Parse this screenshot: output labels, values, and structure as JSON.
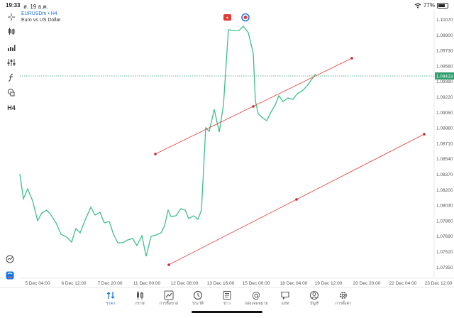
{
  "status": {
    "time": "19:33",
    "date": "ส. 19 ธ.ค.",
    "battery": "77%",
    "battery_level": 0.77
  },
  "symbol": {
    "name": "EURUSDm • H4",
    "description": "Euro vs US Dollar"
  },
  "toolbar": {
    "crosshair_icon": "crosshair-icon",
    "timeframe": "H4"
  },
  "price_axis": [
    "1.10070",
    "1.09900",
    "1.09730",
    "1.09560",
    "1.09390",
    "1.09220",
    "1.09050",
    "1.08880",
    "1.08710",
    "1.08540",
    "1.08370",
    "1.08200",
    "1.08030",
    "1.07860",
    "1.07690",
    "1.07520",
    "1.07350"
  ],
  "current_price": "1.09423",
  "date_axis": [
    "5 Dec 04:00",
    "6 Dec 12:00",
    "7 Dec 20:00",
    "11 Dec 00:00",
    "12 Dec 08:00",
    "13 Dec 16:00",
    "15 Dec 00:00",
    "18 Dec 04:00",
    "19 Dec 12:00",
    "20 Dec 20:00",
    "22 Dec 04:00",
    "23 Dec 12:00"
  ],
  "colors": {
    "series": "#3dbf8a",
    "channel": "#e53935",
    "current_price": "#2e9e6e",
    "accent": "#1a73e8"
  },
  "tabs": [
    {
      "label": "ราคา",
      "icon": "quotes-icon",
      "active": true
    },
    {
      "label": "กราฟ",
      "icon": "chart-icon",
      "active": false
    },
    {
      "label": "การซื้อขาย",
      "icon": "trade-icon",
      "active": false
    },
    {
      "label": "ประวัติ",
      "icon": "history-icon",
      "active": false
    },
    {
      "label": "ข่าว",
      "icon": "news-icon",
      "active": false
    },
    {
      "label": "กล่องจดหมาย",
      "icon": "mailbox-icon",
      "active": false
    },
    {
      "label": "แชท",
      "icon": "chat-icon",
      "active": false
    },
    {
      "label": "บัญชี",
      "icon": "account-icon",
      "active": false
    },
    {
      "label": "การตั้งค่า",
      "icon": "settings-icon",
      "active": false
    }
  ]
}
